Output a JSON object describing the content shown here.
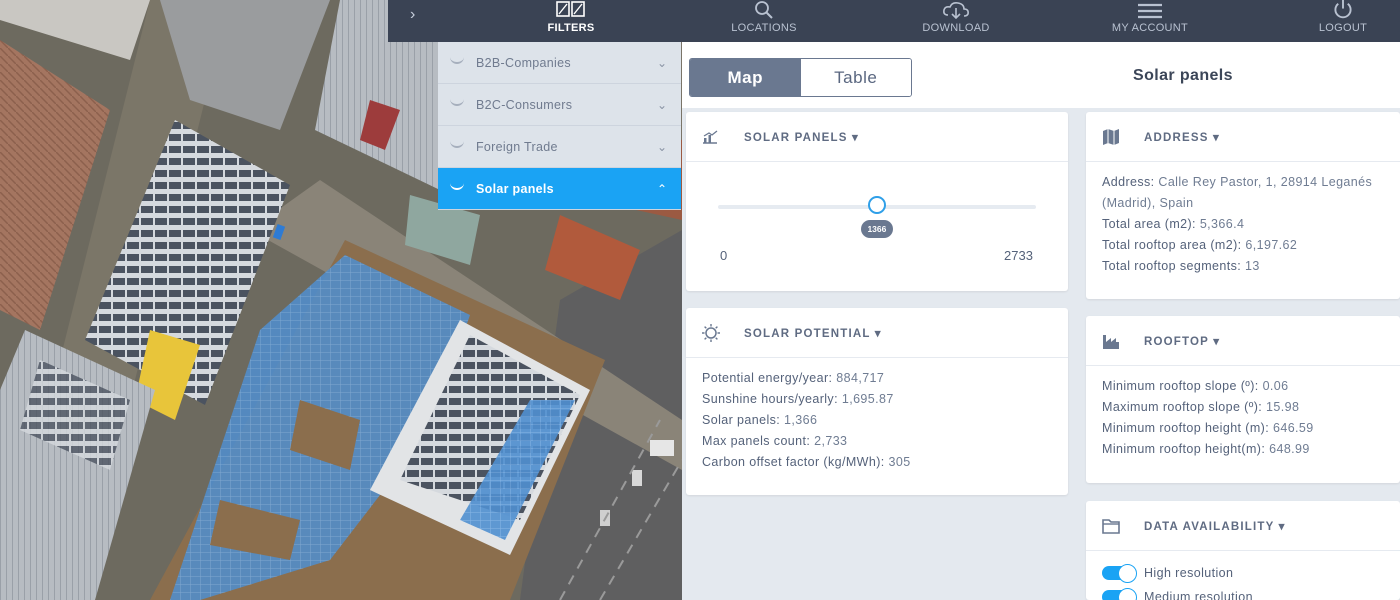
{
  "nav": {
    "items": [
      {
        "label": "FILTERS",
        "icon": "filter-grid-icon",
        "active": true
      },
      {
        "label": "LOCATIONS",
        "icon": "search-icon"
      },
      {
        "label": "DOWNLOAD",
        "icon": "cloud-download-icon"
      },
      {
        "label": "MY ACCOUNT",
        "icon": "menu-icon"
      },
      {
        "label": "LOGOUT",
        "icon": "power-icon"
      }
    ]
  },
  "filters": [
    {
      "label": "B2B-Companies"
    },
    {
      "label": "B2C-Consumers"
    },
    {
      "label": "Foreign Trade"
    },
    {
      "label": "Solar panels",
      "active": true
    }
  ],
  "view_toggle": {
    "map": "Map",
    "table": "Table",
    "selected": "Map"
  },
  "page_title": "Solar panels",
  "solar_panels_card": {
    "title": "SOLAR PANELS",
    "slider": {
      "value": "1366",
      "min": "0",
      "max": "2733",
      "fraction": 0.4998
    }
  },
  "solar_potential_card": {
    "title": "SOLAR POTENTIAL",
    "rows": [
      {
        "label": "Potential energy/year:",
        "value": "884,717"
      },
      {
        "label": "Sunshine hours/yearly:",
        "value": "1,695.87"
      },
      {
        "label": "Solar panels:",
        "value": "1,366"
      },
      {
        "label": "Max panels count:",
        "value": "2,733"
      },
      {
        "label": "Carbon offset factor (kg/MWh):",
        "value": "305"
      }
    ]
  },
  "address_card": {
    "title": "ADDRESS",
    "rows": [
      {
        "label": "Address:",
        "value": "Calle Rey Pastor, 1, 28914 Leganés (Madrid), Spain"
      },
      {
        "label": "Total area (m2):",
        "value": "5,366.4"
      },
      {
        "label": "Total rooftop area (m2):",
        "value": "6,197.62"
      },
      {
        "label": "Total rooftop segments:",
        "value": "13"
      }
    ]
  },
  "rooftop_card": {
    "title": "ROOFTOP",
    "rows": [
      {
        "label": "Minimum rooftop slope (º):",
        "value": "0.06"
      },
      {
        "label": "Maximum rooftop slope (º):",
        "value": "15.98"
      },
      {
        "label": "Minimum rooftop height (m):",
        "value": "646.59"
      },
      {
        "label": "Minimum rooftop height(m):",
        "value": "648.99"
      }
    ]
  },
  "data_availability_card": {
    "title": "DATA AVAILABILITY",
    "toggles": [
      {
        "label": "High resolution",
        "on": true
      },
      {
        "label": "Medium resolution",
        "on": true
      }
    ]
  },
  "colors": {
    "nav_bg": "#3a4354",
    "accent": "#1aa3f4",
    "panel_blue": "#4a8fd6"
  }
}
